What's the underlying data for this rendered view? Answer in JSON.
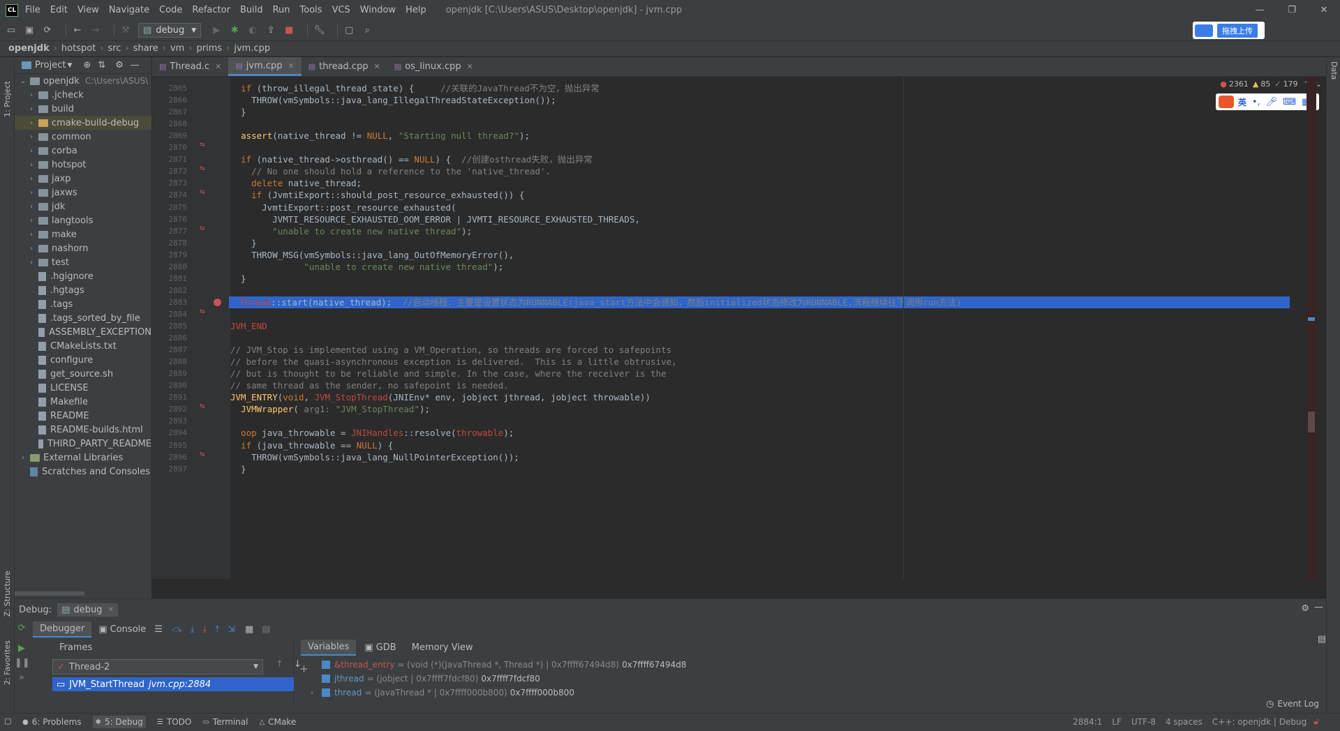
{
  "window": {
    "title": "openjdk [C:\\Users\\ASUS\\Desktop\\openjdk] - jvm.cpp",
    "menu": [
      "File",
      "Edit",
      "View",
      "Navigate",
      "Code",
      "Refactor",
      "Build",
      "Run",
      "Tools",
      "VCS",
      "Window",
      "Help"
    ]
  },
  "toolbar": {
    "run_config": "debug",
    "baidu_upload": "拖拽上传"
  },
  "breadcrumb": [
    "openjdk",
    "hotspot",
    "src",
    "share",
    "vm",
    "prims",
    "jvm.cpp"
  ],
  "project_panel": {
    "title": "Project",
    "root": "openjdk",
    "root_path": "C:\\Users\\ASUS\\",
    "items": [
      {
        "label": ".jcheck",
        "type": "folder"
      },
      {
        "label": "build",
        "type": "folder"
      },
      {
        "label": "cmake-build-debug",
        "type": "folder",
        "selected": true
      },
      {
        "label": "common",
        "type": "folder"
      },
      {
        "label": "corba",
        "type": "folder"
      },
      {
        "label": "hotspot",
        "type": "folder"
      },
      {
        "label": "jaxp",
        "type": "folder"
      },
      {
        "label": "jaxws",
        "type": "folder"
      },
      {
        "label": "jdk",
        "type": "folder"
      },
      {
        "label": "langtools",
        "type": "folder"
      },
      {
        "label": "make",
        "type": "folder"
      },
      {
        "label": "nashorn",
        "type": "folder"
      },
      {
        "label": "test",
        "type": "folder"
      },
      {
        "label": ".hgignore",
        "type": "file"
      },
      {
        "label": ".hgtags",
        "type": "file"
      },
      {
        "label": ".tags",
        "type": "file"
      },
      {
        "label": ".tags_sorted_by_file",
        "type": "file"
      },
      {
        "label": "ASSEMBLY_EXCEPTION",
        "type": "file"
      },
      {
        "label": "CMakeLists.txt",
        "type": "file"
      },
      {
        "label": "configure",
        "type": "file"
      },
      {
        "label": "get_source.sh",
        "type": "file"
      },
      {
        "label": "LICENSE",
        "type": "file"
      },
      {
        "label": "Makefile",
        "type": "file"
      },
      {
        "label": "README",
        "type": "file"
      },
      {
        "label": "README-builds.html",
        "type": "file"
      },
      {
        "label": "THIRD_PARTY_README",
        "type": "file"
      }
    ],
    "external_libraries": "External Libraries",
    "scratches": "Scratches and Consoles"
  },
  "tabs": [
    {
      "label": "Thread.c",
      "active": false
    },
    {
      "label": "jvm.cpp",
      "active": true
    },
    {
      "label": "thread.cpp",
      "active": false
    },
    {
      "label": "os_linux.cpp",
      "active": false
    }
  ],
  "inspections": {
    "errors": "2361",
    "warnings": "85",
    "weak": "179"
  },
  "code": {
    "lines": [
      {
        "n": "2865",
        "html": "  <span class='kw'>if</span> (throw_illegal_thread_state) {     <span class='cm'>//关联的JavaThread不为空，抛出异常</span>"
      },
      {
        "n": "2866",
        "html": "    THROW(vmSymbols::java_lang_IllegalThreadStateException());"
      },
      {
        "n": "2867",
        "html": "  }"
      },
      {
        "n": "2868",
        "html": ""
      },
      {
        "n": "2869",
        "html": "  <span class='fn'>assert</span>(native_thread != <span class='kw'>NULL</span>, <span class='str'>\"Starting null thread?\"</span>);"
      },
      {
        "n": "2870",
        "html": ""
      },
      {
        "n": "2871",
        "html": "  <span class='kw'>if</span> (native_thread->osthread() == <span class='kw'>NULL</span>) {  <span class='cm'>//创建osthread失败，抛出异常</span>"
      },
      {
        "n": "2872",
        "html": "    <span class='cm'>// No one should hold a reference to the 'native_thread'.</span>"
      },
      {
        "n": "2873",
        "html": "    <span class='kw'>delete</span> native_thread;"
      },
      {
        "n": "2874",
        "html": "    <span class='kw'>if</span> (JvmtiExport::should_post_resource_exhausted()) {"
      },
      {
        "n": "2875",
        "html": "      JvmtiExport::post_resource_exhausted("
      },
      {
        "n": "2876",
        "html": "        JVMTI_RESOURCE_EXHAUSTED_OOM_ERROR | JVMTI_RESOURCE_EXHAUSTED_THREADS,"
      },
      {
        "n": "2877",
        "html": "        <span class='str'>\"unable to create new native thread\"</span>);"
      },
      {
        "n": "2878",
        "html": "    }"
      },
      {
        "n": "2879",
        "html": "    THROW_MSG(vmSymbols::java_lang_OutOfMemoryError(),"
      },
      {
        "n": "2880",
        "html": "              <span class='str'>\"unable to create new native thread\"</span>);"
      },
      {
        "n": "2881",
        "html": "  }"
      },
      {
        "n": "2882",
        "html": ""
      },
      {
        "n": "2883",
        "html": "  <span class='mac'>Thread</span>::start(native_thread);  <span class='cm'>//启动线程，主要是设置状态为RUNNABLE(java_start方法中会感知，然后initialized状态修改为RUNNABLE,流程继续往下调用run方法)</span>",
        "highlight": true
      },
      {
        "n": "2884",
        "html": ""
      },
      {
        "n": "2885",
        "html": "<span class='mac'>JVM_END</span>"
      },
      {
        "n": "2886",
        "html": ""
      },
      {
        "n": "2887",
        "html": "<span class='cm'>// JVM_Stop is implemented using a VM_Operation, so threads are forced to safepoints</span>"
      },
      {
        "n": "2888",
        "html": "<span class='cm'>// before the quasi-asynchronous exception is delivered.  This is a little obtrusive,</span>"
      },
      {
        "n": "2889",
        "html": "<span class='cm'>// but is thought to be reliable and simple. In the case, where the receiver is the</span>"
      },
      {
        "n": "2890",
        "html": "<span class='cm'>// same thread as the sender, no safepoint is needed.</span>"
      },
      {
        "n": "2891",
        "html": "<span class='fn'>JVM_ENTRY</span>(<span class='kw'>void</span>, <span class='mac'>JVM_StopThread</span>(JNIEnv* env, jobject jthread, jobject throwable))"
      },
      {
        "n": "2892",
        "html": "  <span class='fn'>JVMWrapper</span>( <span class='cm'>arg1:</span> <span class='str'>\"JVM_StopThread\"</span>);"
      },
      {
        "n": "2893",
        "html": ""
      },
      {
        "n": "2894",
        "html": "  <span class='kw'>oop</span> java_throwable = <span class='mac'>JNIHandles</span>::resolve(<span class='mac'>throwable</span>);"
      },
      {
        "n": "2895",
        "html": "  <span class='kw'>if</span> (java_throwable == <span class='kw'>NULL</span>) {"
      },
      {
        "n": "2896",
        "html": "    THROW(vmSymbols::java_lang_NullPointerException());"
      },
      {
        "n": "2897",
        "html": "  }"
      }
    ]
  },
  "debug": {
    "label": "Debug:",
    "session": "debug",
    "tabs": [
      "Debugger",
      "Console"
    ],
    "frames_label": "Frames",
    "thread": "Thread-2",
    "frame": "JVM_StartThread",
    "frame_loc": "jvm.cpp:2884",
    "var_tabs": [
      "Variables",
      "GDB",
      "Memory View"
    ],
    "variables": [
      {
        "name": "&thread_entry",
        "type": "= (void (*)(JavaThread *, Thread *) | 0x7ffff67494d8)",
        "value": "0x7ffff67494d8"
      },
      {
        "name": "jthread",
        "type": "= (jobject | 0x7ffff7fdcf80)",
        "value": "0x7ffff7fdcf80"
      },
      {
        "name": "thread",
        "type": "= (JavaThread * | 0x7ffff000b800)",
        "value": "0x7ffff000b800"
      }
    ]
  },
  "statusbar": {
    "tools": [
      "6: Problems",
      "5: Debug",
      "TODO",
      "Terminal",
      "CMake"
    ],
    "event_log": "Event Log",
    "position": "2884:1",
    "line_sep": "LF",
    "encoding": "UTF-8",
    "indent": "4 spaces",
    "context": "C++: openjdk | Debug"
  },
  "side_labels": {
    "project": "1: Project",
    "structure": "Z: Structure",
    "favorites": "2: Favorites",
    "database": "Data"
  }
}
